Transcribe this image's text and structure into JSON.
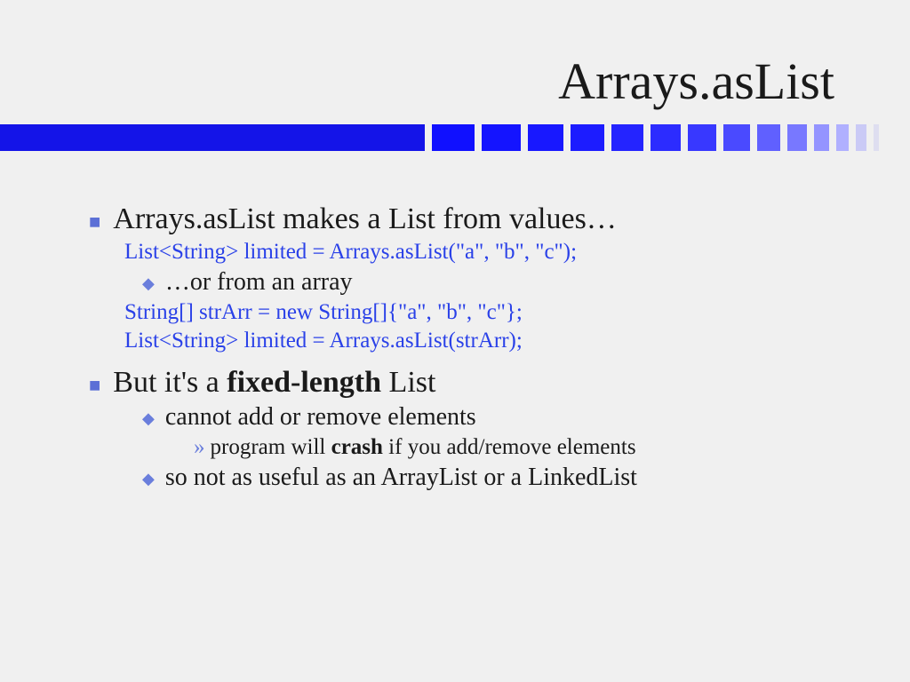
{
  "title": "Arrays.asList",
  "bullets": {
    "b1": "Arrays.asList makes a List from values…",
    "code1": "List<String> limited = Arrays.asList(\"a\", \"b\", \"c\");",
    "b1a": "…or from an array",
    "code2": "String[] strArr = new String[]{\"a\", \"b\", \"c\"};",
    "code3": "List<String> limited = Arrays.asList(strArr);",
    "b2_pre": "But it's a ",
    "b2_bold": "fixed-length",
    "b2_post": " List",
    "b2a": "cannot add or remove elements",
    "b2a1_pre": "program will ",
    "b2a1_bold": "crash",
    "b2a1_post": " if you add/remove elements",
    "b2b": "so not as useful as an ArrayList or a LinkedList"
  },
  "bar_segments": [
    {
      "w": 48,
      "c": "#1010ff"
    },
    {
      "w": 44,
      "c": "#1414ff"
    },
    {
      "w": 40,
      "c": "#1818ff"
    },
    {
      "w": 38,
      "c": "#1c1cff"
    },
    {
      "w": 36,
      "c": "#2424ff"
    },
    {
      "w": 34,
      "c": "#2c2cff"
    },
    {
      "w": 32,
      "c": "#3838ff"
    },
    {
      "w": 30,
      "c": "#4a4aff"
    },
    {
      "w": 26,
      "c": "#6060ff"
    },
    {
      "w": 22,
      "c": "#7878ff"
    },
    {
      "w": 17,
      "c": "#9494ff"
    },
    {
      "w": 14,
      "c": "#b0b0ff"
    },
    {
      "w": 12,
      "c": "#cacaf6"
    },
    {
      "w": 6,
      "c": "#dedef0"
    }
  ]
}
